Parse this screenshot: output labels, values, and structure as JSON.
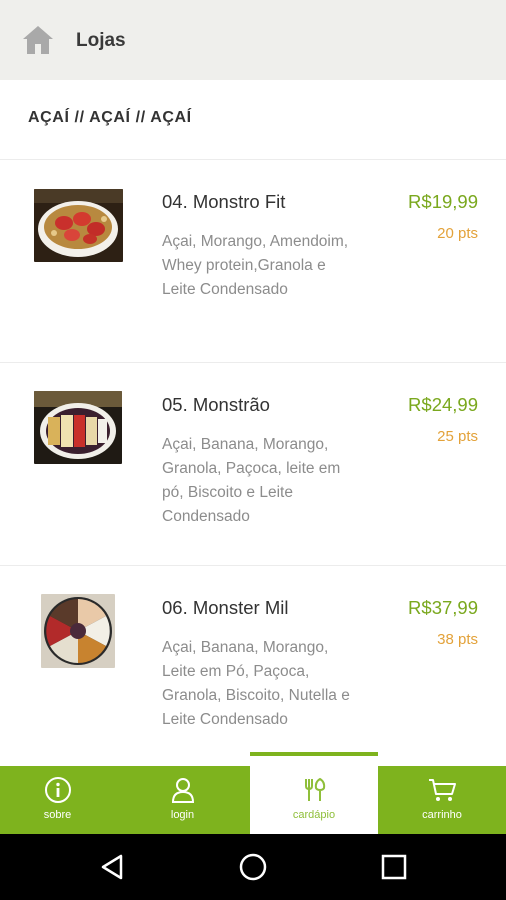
{
  "header": {
    "title": "Lojas",
    "home_icon": "home-icon"
  },
  "category": {
    "title": "AÇAÍ // AÇAÍ // AÇAÍ"
  },
  "products": [
    {
      "name": "04. Monstro Fit",
      "description": "Açai, Morango, Amendoim, Whey protein,Granola e Leite Condensado",
      "price": "R$19,99",
      "points": "20 pts"
    },
    {
      "name": "05. Monstrão",
      "description": "Açai, Banana, Morango, Granola, Paçoca, leite em pó, Biscoito e Leite Condensado",
      "price": "R$24,99",
      "points": "25 pts"
    },
    {
      "name": "06. Monster Mil",
      "description": "Açai, Banana, Morango, Leite em Pó, Paçoca, Granola, Biscoito, Nutella e Leite Condensado",
      "price": "R$37,99",
      "points": "38 pts"
    }
  ],
  "bottom_nav": [
    {
      "label": "sobre",
      "icon": "info-icon",
      "active": false
    },
    {
      "label": "login",
      "icon": "user-icon",
      "active": false
    },
    {
      "label": "cardápio",
      "icon": "cutlery-icon",
      "active": true
    },
    {
      "label": "carrinho",
      "icon": "cart-icon",
      "active": false
    }
  ],
  "colors": {
    "accent_green": "#7eb31e",
    "price_green": "#7aa81e",
    "points_orange": "#e3a23a",
    "header_bg": "#efefec"
  },
  "system_nav": [
    "back-icon",
    "home-circle-icon",
    "recents-icon"
  ]
}
